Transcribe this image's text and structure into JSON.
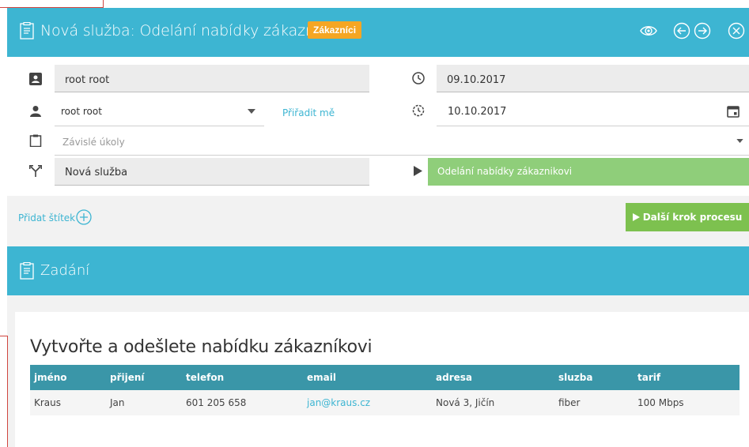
{
  "header": {
    "title": "Nová služba: Odelání nabídky zákaznikovi",
    "badge": "Zákazníci"
  },
  "form": {
    "owner_name": "root root",
    "date_start": "09.10.2017",
    "assignee_name": "root root",
    "assign_me": "Přiřadit mě",
    "date_due": "10.10.2017",
    "dependent_tasks_placeholder": "Závislé úkoly",
    "process_name": "Nová služba",
    "process_step": "Odelání nabídky zákaznikovi"
  },
  "actions": {
    "add_tag": "Přidat štítek",
    "next_step": "Další krok procesu"
  },
  "section": {
    "title": "Zadání"
  },
  "content": {
    "heading": "Vytvořte a odešlete nabídku zákazníkovi",
    "table": {
      "headers": [
        "jméno",
        "přijení",
        "telefon",
        "email",
        "adresa",
        "sluzba",
        "tarif"
      ],
      "rows": [
        [
          "Kraus",
          "Jan",
          "601 205 658",
          "jan@kraus.cz",
          "Nová 3, Jičín",
          "fiber",
          "100 Mbps"
        ]
      ]
    }
  }
}
